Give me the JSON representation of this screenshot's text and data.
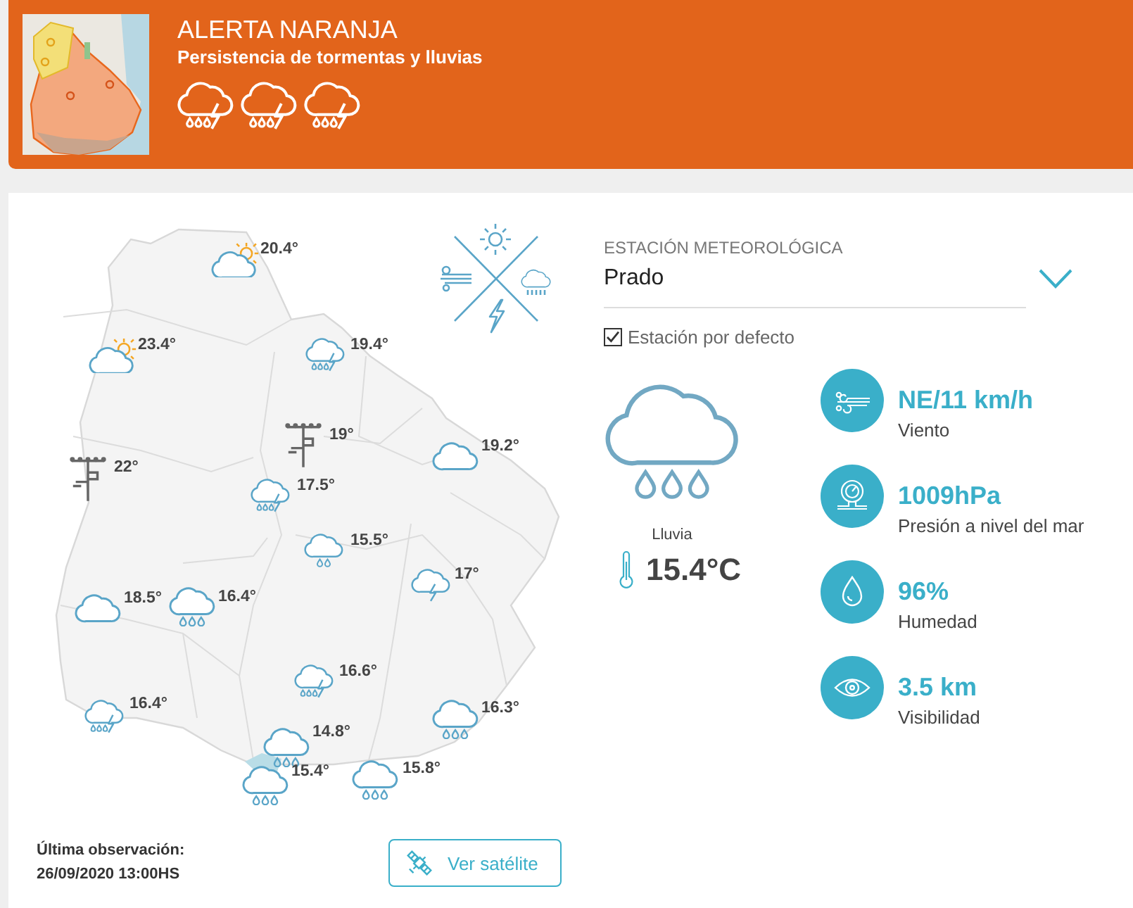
{
  "alert": {
    "title": "ALERTA NARANJA",
    "subtitle": "Persistencia de tormentas y lluvias",
    "icons": [
      {
        "kind": "storm-rain"
      },
      {
        "kind": "storm-rain"
      },
      {
        "kind": "storm-rain"
      }
    ]
  },
  "map": {
    "stations": [
      {
        "kind": "partly-cloudy",
        "reading": "20.4°"
      },
      {
        "kind": "partly-cloudy",
        "reading": "23.4°"
      },
      {
        "kind": "storm-rain",
        "reading": "19.4°"
      },
      {
        "kind": "station",
        "reading": "19°"
      },
      {
        "kind": "cloud",
        "reading": "19.2°"
      },
      {
        "kind": "station",
        "reading": "22°"
      },
      {
        "kind": "storm-rain",
        "reading": "17.5°"
      },
      {
        "kind": "light-rain",
        "reading": "15.5°"
      },
      {
        "kind": "storm",
        "reading": "17°"
      },
      {
        "kind": "rain",
        "reading": "16.4°"
      },
      {
        "kind": "cloud",
        "reading": "18.5°"
      },
      {
        "kind": "storm-rain",
        "reading": "16.6°"
      },
      {
        "kind": "storm-rain",
        "reading": "16.4°"
      },
      {
        "kind": "rain",
        "reading": "16.3°"
      },
      {
        "kind": "rain",
        "reading": "14.8°"
      },
      {
        "kind": "rain",
        "reading": "15.8°"
      },
      {
        "kind": "rain",
        "reading": "15.4°"
      }
    ]
  },
  "station": {
    "label": "ESTACIÓN METEOROLÓGICA",
    "value": "Prado",
    "default_station": {
      "label": "Estación por defecto",
      "checked": true
    }
  },
  "current": {
    "kind": "rain",
    "condition": "Lluvia",
    "temperature": "15.4°C"
  },
  "stats": [
    {
      "kind": "wind",
      "value": "NE/11 km/h",
      "label": "Viento"
    },
    {
      "kind": "pressure",
      "value": "1009hPa",
      "label": "Presión a nivel del mar"
    },
    {
      "kind": "humidity",
      "value": "96%",
      "label": "Humedad"
    },
    {
      "kind": "visibility",
      "value": "3.5 km",
      "label": "Visibilidad"
    }
  ],
  "footer": {
    "label": "Última observación:",
    "time": "26/09/2020 13:00HS",
    "button": "Ver satélite"
  }
}
